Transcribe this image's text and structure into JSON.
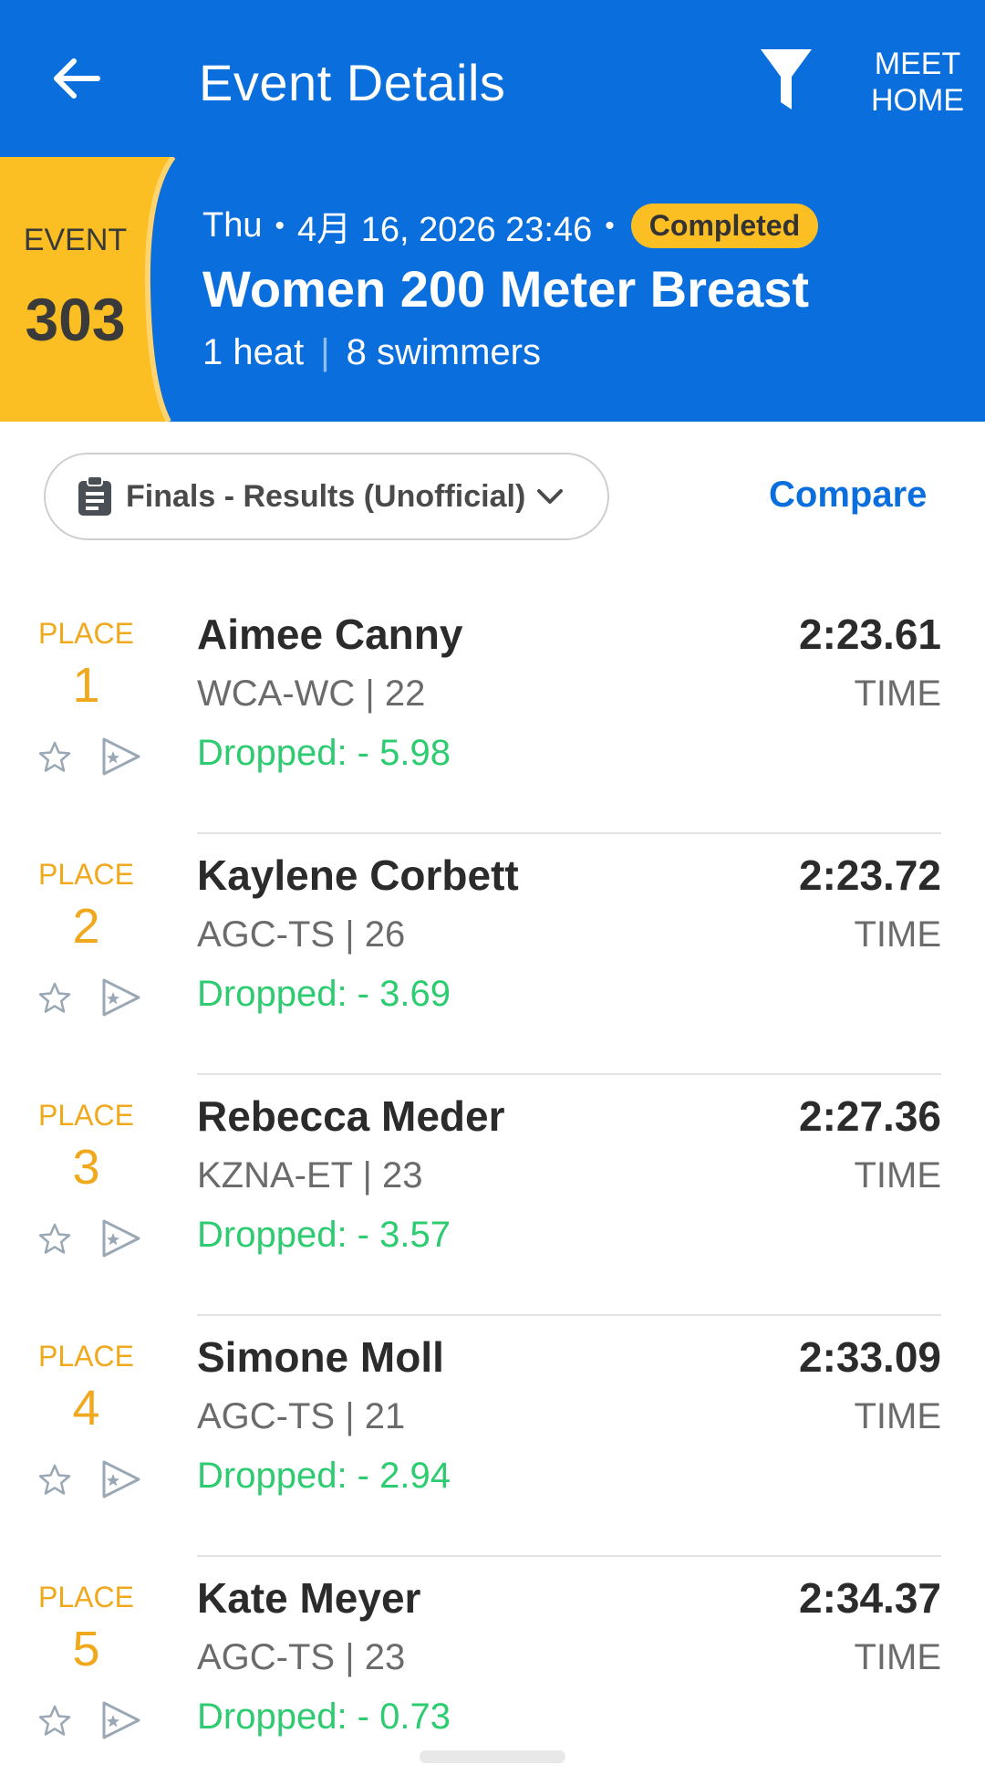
{
  "appbar": {
    "title": "Event Details",
    "meet_home_line1": "MEET",
    "meet_home_line2": "HOME"
  },
  "event": {
    "label": "EVENT",
    "number": "303",
    "day": "Thu",
    "date": "4月 16, 2026 23:46",
    "status": "Completed",
    "name": "Women 200 Meter Breast",
    "heats": "1 heat",
    "swimmers": "8 swimmers"
  },
  "filters": {
    "round": "Finals - Results (Unofficial)",
    "compare": "Compare"
  },
  "results": [
    {
      "place_label": "PLACE",
      "place": "1",
      "name": "Aimee Canny",
      "team_age": "WCA-WC | 22",
      "dropped": "Dropped: - 5.98",
      "time": "2:23.61",
      "time_label": "TIME"
    },
    {
      "place_label": "PLACE",
      "place": "2",
      "name": "Kaylene Corbett",
      "team_age": "AGC-TS | 26",
      "dropped": "Dropped: - 3.69",
      "time": "2:23.72",
      "time_label": "TIME"
    },
    {
      "place_label": "PLACE",
      "place": "3",
      "name": "Rebecca Meder",
      "team_age": "KZNA-ET | 23",
      "dropped": "Dropped: - 3.57",
      "time": "2:27.36",
      "time_label": "TIME"
    },
    {
      "place_label": "PLACE",
      "place": "4",
      "name": "Simone Moll",
      "team_age": "AGC-TS | 21",
      "dropped": "Dropped: - 2.94",
      "time": "2:33.09",
      "time_label": "TIME"
    },
    {
      "place_label": "PLACE",
      "place": "5",
      "name": "Kate Meyer",
      "team_age": "AGC-TS | 23",
      "dropped": "Dropped: - 0.73",
      "time": "2:34.37",
      "time_label": "TIME"
    }
  ],
  "icons": {
    "back": "arrow-left-icon",
    "filter": "filter-funnel-icon",
    "clipboard": "clipboard-icon",
    "chevron": "chevron-down-icon",
    "favorite": "star-outline-icon",
    "flag": "flag-icon"
  },
  "colors": {
    "primary": "#0a6fdc",
    "accent": "#fbbf24",
    "place": "#f0a81c",
    "dropped": "#2ecc71"
  }
}
